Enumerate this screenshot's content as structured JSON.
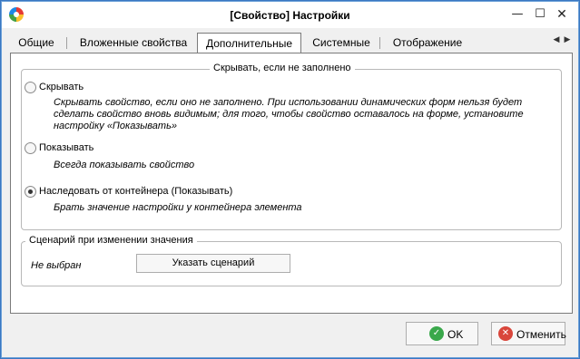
{
  "window": {
    "title": "[Свойство] Настройки",
    "min_glyph": "—",
    "max_glyph": "☐",
    "close_glyph": "✕"
  },
  "tabs": [
    {
      "label": "Общие",
      "active": false
    },
    {
      "label": "Вложенные свойства",
      "active": false
    },
    {
      "label": "Дополнительные",
      "active": true
    },
    {
      "label": "Системные",
      "active": false
    },
    {
      "label": "Отображение",
      "active": false
    }
  ],
  "tab_scroll": {
    "left_glyph": "◀",
    "right_glyph": "▶"
  },
  "hide_group": {
    "legend": "Скрывать, если не заполнено",
    "options": [
      {
        "label": "Скрывать",
        "description": "Скрывать свойство, если оно не заполнено. При использовании динамических форм нельзя будет сделать свойство вновь видимым; для того, чтобы свойство оставалось на форме, установите настройку «Показывать»",
        "checked": false
      },
      {
        "label": "Показывать",
        "description": "Всегда показывать свойство",
        "checked": false
      },
      {
        "label": "Наследовать от контейнера (Показывать)",
        "description": "Брать значение настройки у контейнера элемента",
        "checked": true
      }
    ]
  },
  "script_group": {
    "legend": "Сценарий при изменении значения",
    "status": "Не выбран",
    "button_label": "Указать сценарий"
  },
  "footer": {
    "ok_label": "OK",
    "ok_icon": "✓",
    "cancel_label": "Отменить",
    "cancel_icon": "✕"
  },
  "colors": {
    "window_border": "#3a78c2",
    "ok_icon": "#3aa84b",
    "cancel_icon": "#d9463b"
  }
}
